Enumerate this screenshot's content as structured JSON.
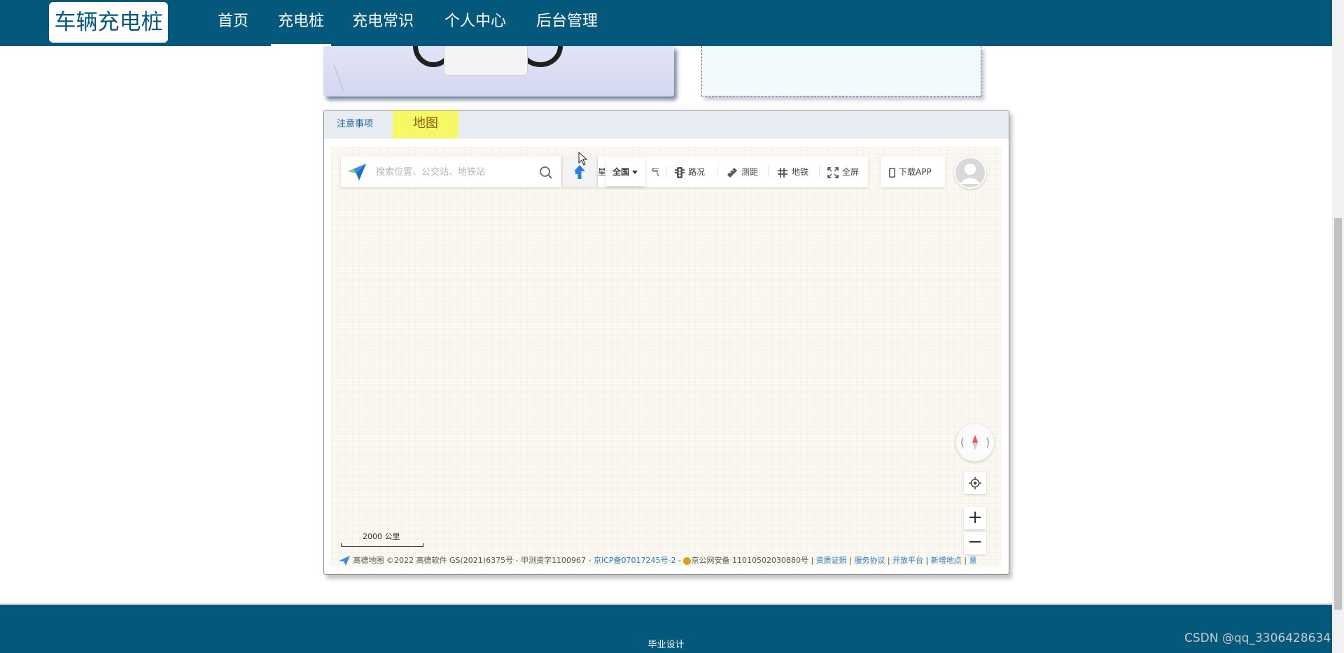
{
  "navbar": {
    "brand": "车辆充电桩",
    "items": [
      {
        "label": "首页",
        "active": false
      },
      {
        "label": "充电桩",
        "active": true
      },
      {
        "label": "充电常识",
        "active": false
      },
      {
        "label": "个人中心",
        "active": false
      },
      {
        "label": "后台管理",
        "active": false
      }
    ]
  },
  "tabs": {
    "notice": "注意事项",
    "map": "地图"
  },
  "map": {
    "search_placeholder": "搜索位置、公交站、地铁站",
    "city": "全国",
    "tools": [
      "星",
      "气",
      "路况",
      "测距",
      "地铁",
      "全屏"
    ],
    "download_app": "下载APP",
    "scale": "2000 公里",
    "copyright": {
      "brand": "高德地图",
      "text": "©2022 高德软件 GS(2021)6375号 - 甲测资字1100967 - ",
      "icp": "京ICP备07017245号-2",
      "dash": " - ",
      "police": "京公网安备 11010502030880号",
      "sep": " | ",
      "links": [
        "资质证照",
        "服务协议",
        "开放平台",
        "新增地点",
        "意"
      ]
    }
  },
  "footer": {
    "text": "毕业设计"
  },
  "watermark": "CSDN @qq_3306428634",
  "colors": {
    "primary": "#04587c",
    "map_tab_highlight": "#f6f966",
    "map_background": "#fbf8f1",
    "link": "#2879c5"
  }
}
